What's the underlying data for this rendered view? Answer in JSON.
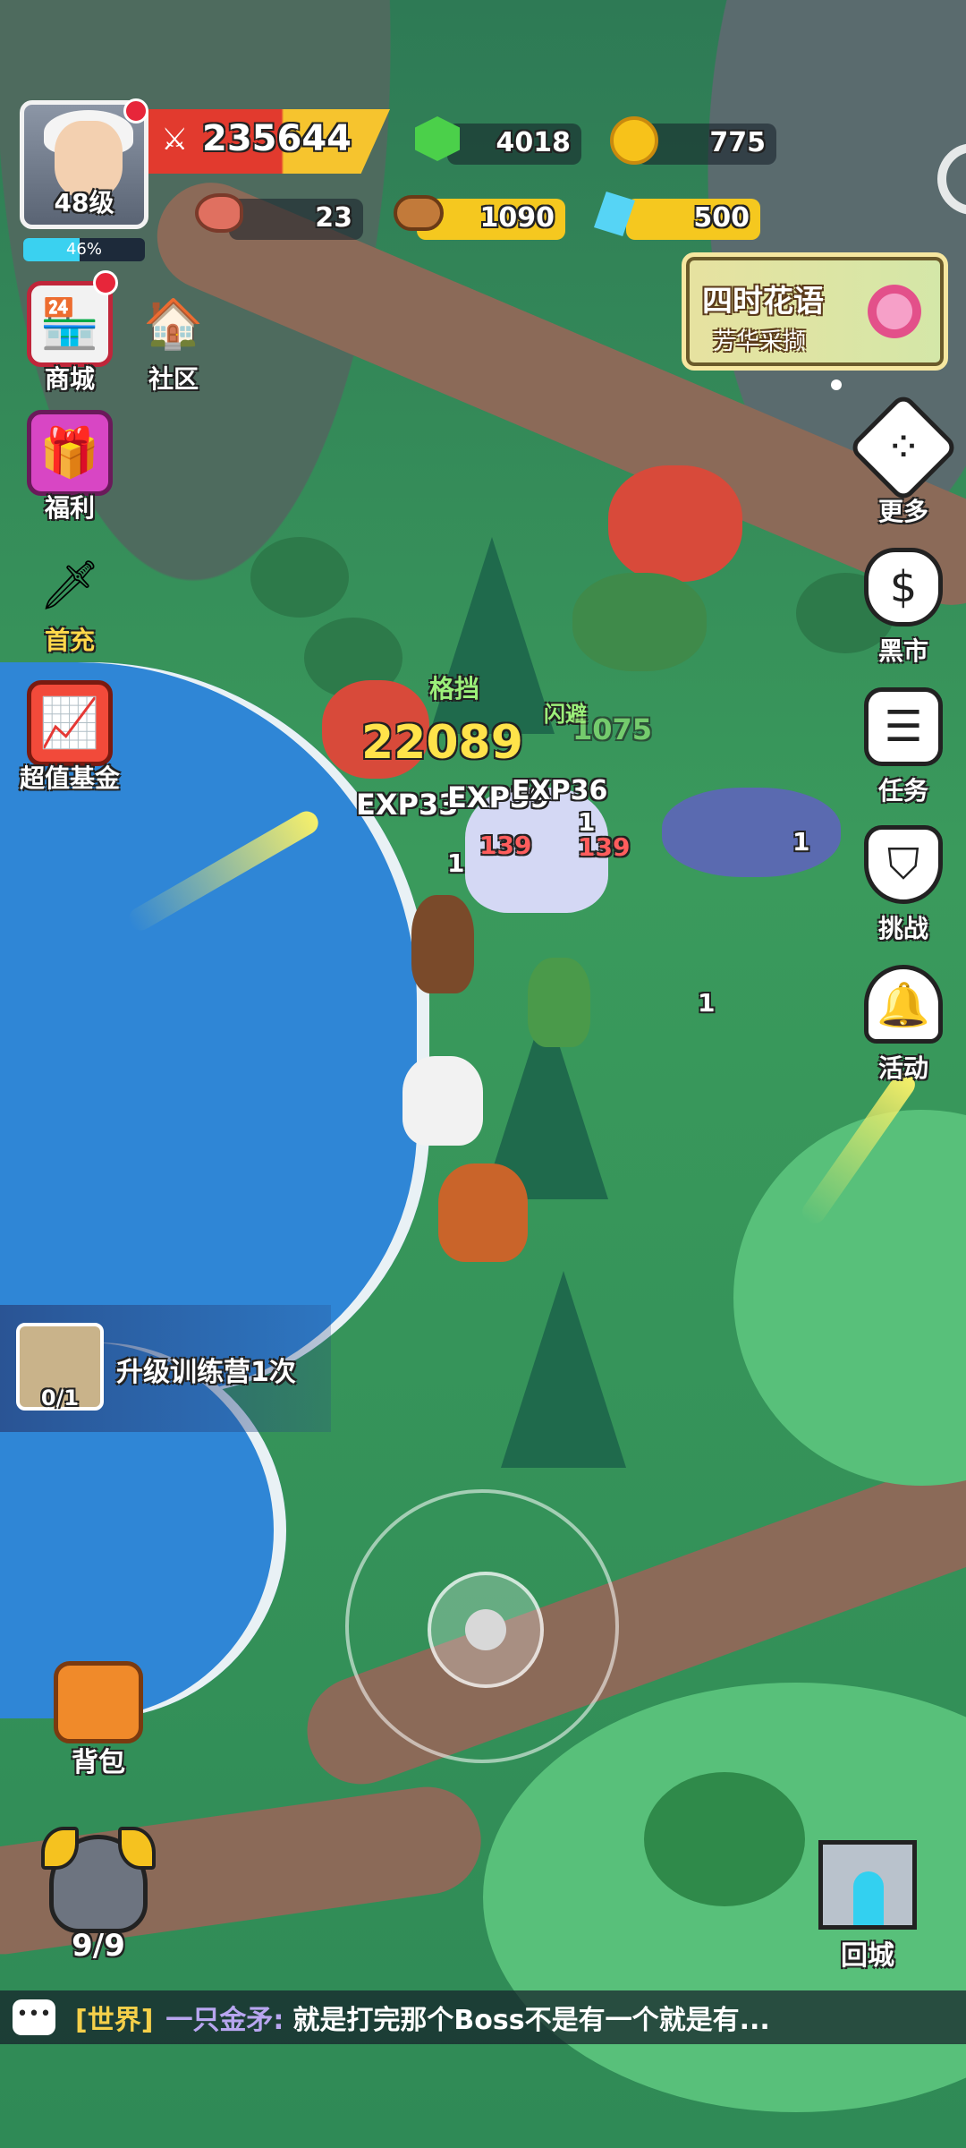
{
  "player": {
    "level": "48级",
    "xp_percent": "46%",
    "xp_fraction": 0.46,
    "combat_power": "235644"
  },
  "resources": {
    "gems": "4018",
    "coins": "775",
    "meat": "23",
    "wood": "1090",
    "crystal": "500"
  },
  "event_banner": {
    "title": "四时花语",
    "subtitle": "芳华采撷"
  },
  "left_menu": {
    "shop": "商城",
    "community": "社区",
    "welfare": "福利",
    "first_recharge": "首充",
    "value_fund": "超值基金"
  },
  "right_menu": {
    "more": "更多",
    "black_market": "黑市",
    "tasks": "任务",
    "challenge": "挑战",
    "events": "活动"
  },
  "quest": {
    "progress": "0/1",
    "text": "升级训练营1次"
  },
  "bottom": {
    "backpack": "背包",
    "team_count": "9/9",
    "return_city": "回城"
  },
  "chat": {
    "channel": "[世界]",
    "user": "一只金矛:",
    "message": "就是打完那个Boss不是有一个就是有..."
  },
  "combat_text": {
    "block": "格挡",
    "dodge": "闪避",
    "damage_big": "22089",
    "heal": "1075",
    "exp1": "EXP33",
    "exp2": "EXP39",
    "exp3": "EXP36",
    "dmg1": "139",
    "dmg2": "139",
    "one_a": "1",
    "one_b": "1",
    "one_c": "1",
    "one_d": "1"
  },
  "colors": {
    "power_red": "#e23a2e",
    "power_gold": "#f6c42e",
    "xp_fill": "#3ad1f0",
    "chat_channel": "#f5d04a",
    "chat_user": "#b8a6f0"
  }
}
